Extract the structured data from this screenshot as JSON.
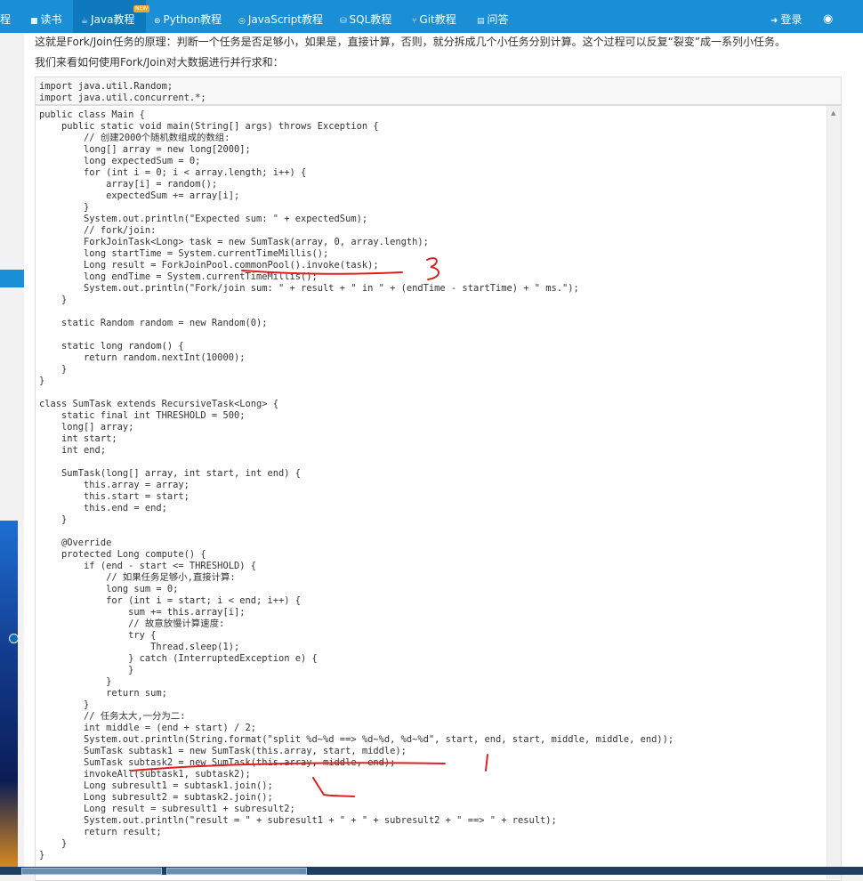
{
  "nav": {
    "items": [
      {
        "label": "教程",
        "icon": "book-icon"
      },
      {
        "label": "读书",
        "icon": "book-icon"
      },
      {
        "label": "Java教程",
        "icon": "coffee-icon",
        "badge": "NEW"
      },
      {
        "label": "Python教程",
        "icon": "python-icon"
      },
      {
        "label": "JavaScript教程",
        "icon": "js-icon"
      },
      {
        "label": "SQL教程",
        "icon": "database-icon"
      },
      {
        "label": "Git教程",
        "icon": "git-icon"
      },
      {
        "label": "问答",
        "icon": "comment-icon"
      }
    ],
    "login_label": "登录",
    "globe_icon": "globe-icon",
    "accent_color": "#1a8fd6"
  },
  "intro": {
    "line1": "这就是Fork/Join任务的原理：判断一个任务是否足够小，如果是，直接计算，否则，就分拆成几个小任务分别计算。这个过程可以反复“裂变”成一系列小任务。",
    "line2": "我们来看如何使用Fork/Join对大数据进行并行求和："
  },
  "code": {
    "imports": "import java.util.Random;\nimport java.util.concurrent.*;",
    "main": "public class Main {\n    public static void main(String[] args) throws Exception {\n        // 创建2000个随机数组成的数组:\n        long[] array = new long[2000];\n        long expectedSum = 0;\n        for (int i = 0; i < array.length; i++) {\n            array[i] = random();\n            expectedSum += array[i];\n        }\n        System.out.println(\"Expected sum: \" + expectedSum);\n        // fork/join:\n        ForkJoinTask<Long> task = new SumTask(array, 0, array.length);\n        long startTime = System.currentTimeMillis();\n        Long result = ForkJoinPool.commonPool().invoke(task);\n        long endTime = System.currentTimeMillis();\n        System.out.println(\"Fork/join sum: \" + result + \" in \" + (endTime - startTime) + \" ms.\");\n    }\n\n    static Random random = new Random(0);\n\n    static long random() {\n        return random.nextInt(10000);\n    }\n}\n\nclass SumTask extends RecursiveTask<Long> {\n    static final int THRESHOLD = 500;\n    long[] array;\n    int start;\n    int end;\n\n    SumTask(long[] array, int start, int end) {\n        this.array = array;\n        this.start = start;\n        this.end = end;\n    }\n\n    @Override\n    protected Long compute() {\n        if (end - start <= THRESHOLD) {\n            // 如果任务足够小,直接计算:\n            long sum = 0;\n            for (int i = start; i < end; i++) {\n                sum += this.array[i];\n                // 故意放慢计算速度:\n                try {\n                    Thread.sleep(1);\n                } catch (InterruptedException e) {\n                }\n            }\n            return sum;\n        }\n        // 任务太大,一分为二:\n        int middle = (end + start) / 2;\n        System.out.println(String.format(\"split %d~%d ==> %d~%d, %d~%d\", start, end, start, middle, middle, end));\n        SumTask subtask1 = new SumTask(this.array, start, middle);\n        SumTask subtask2 = new SumTask(this.array, middle, end);\n        invokeAll(subtask1, subtask2);\n        Long subresult1 = subtask1.join();\n        Long subresult2 = subtask2.join();\n        Long result = subresult1 + subresult2;\n        System.out.println(\"result = \" + subresult1 + \" + \" + subresult2 + \" ==> \" + result);\n        return result;\n    }\n}"
  },
  "annotation_color": "#e02020"
}
